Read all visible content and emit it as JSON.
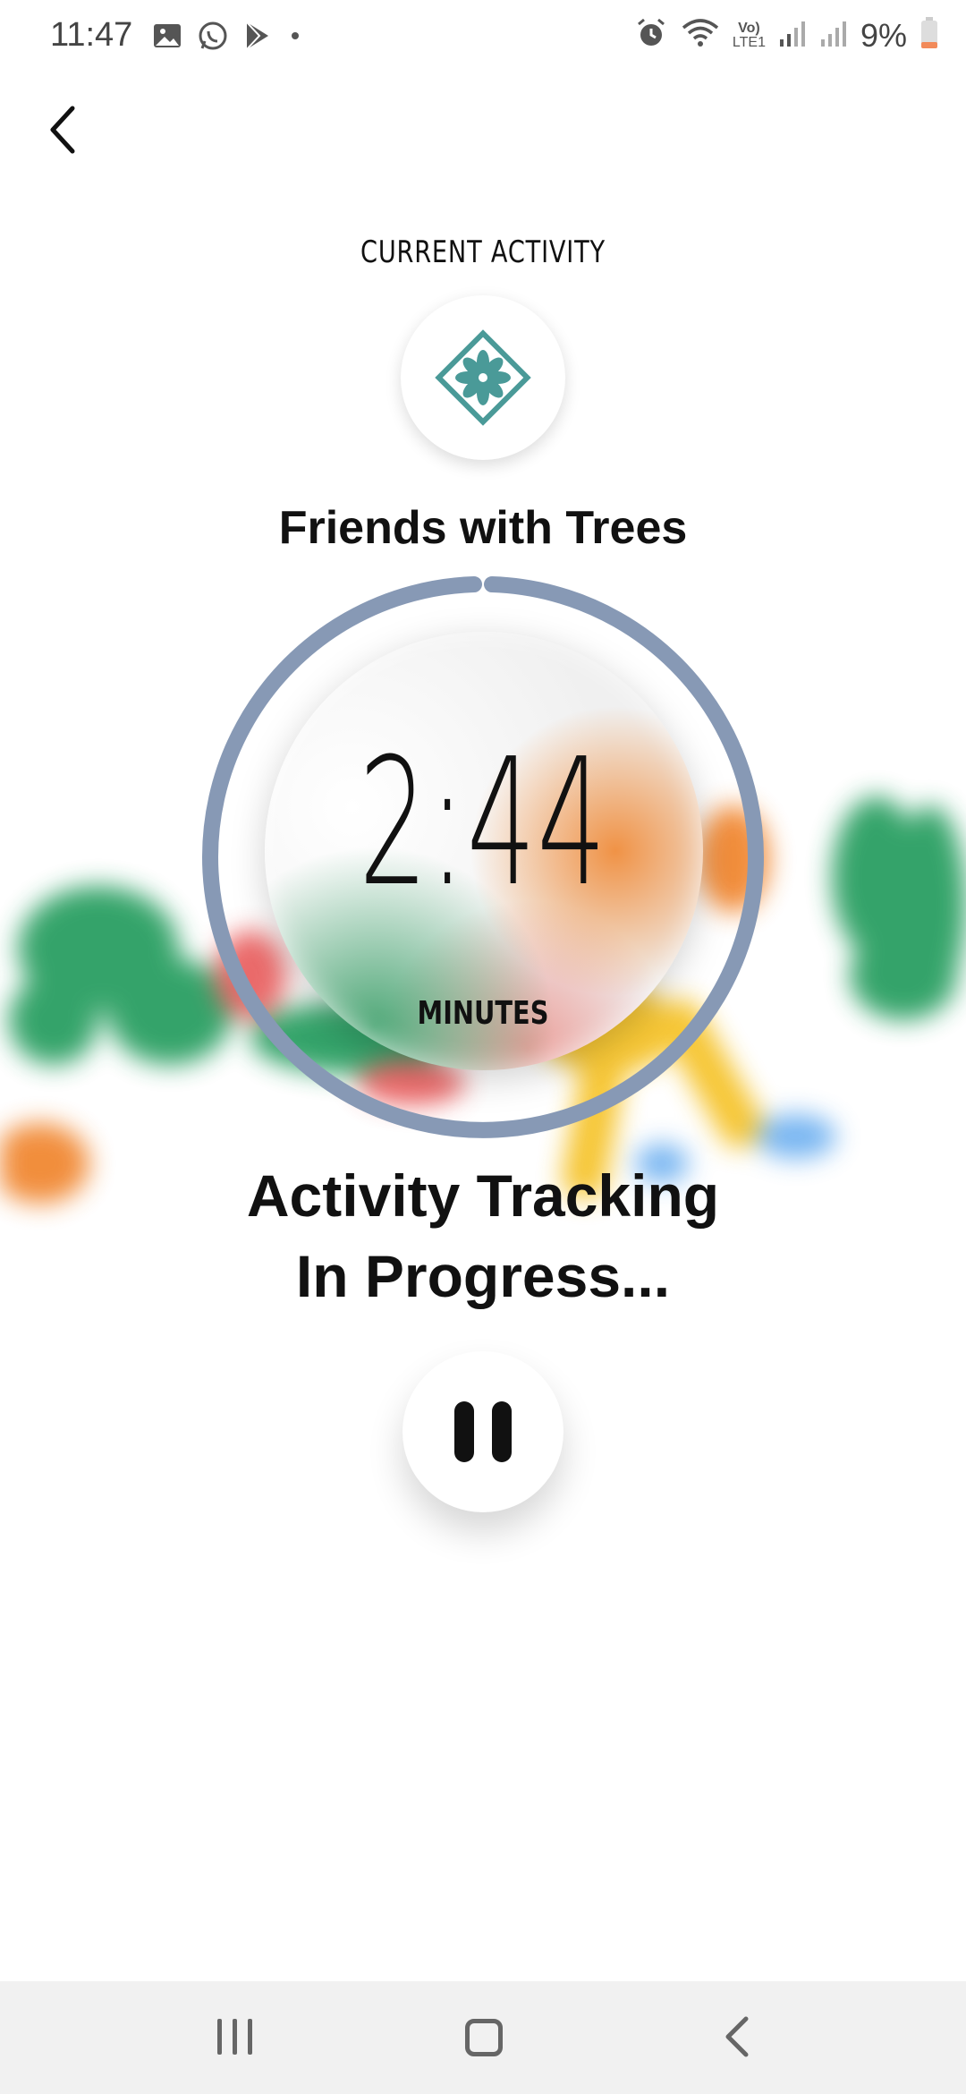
{
  "status_bar": {
    "time": "11:47",
    "left_icons": [
      "gallery-icon",
      "whatsapp-icon",
      "play-store-icon",
      "dot-icon"
    ],
    "right_icons": [
      "alarm-icon",
      "wifi-icon",
      "volte-icon",
      "signal-icon",
      "signal-icon"
    ],
    "volte_label_top": "Vo)",
    "volte_label_bottom": "LTE1",
    "battery_percent": "9%"
  },
  "header": {
    "back_icon": "chevron-left-icon",
    "section_label": "CURRENT ACTIVITY",
    "activity_icon": "flower-diamond-icon",
    "activity_name": "Friends with Trees"
  },
  "timer": {
    "value": "2:44",
    "unit": "MINUTES",
    "ring_color": "#8799b5"
  },
  "status": {
    "line1": "Activity Tracking",
    "line2": "In Progress..."
  },
  "controls": {
    "pause_icon": "pause-icon"
  },
  "nav_bar": {
    "items": [
      "recents-icon",
      "home-icon",
      "back-icon"
    ]
  },
  "colors": {
    "accent_teal": "#4a9a98",
    "ring": "#8799b5",
    "text": "#111111"
  }
}
